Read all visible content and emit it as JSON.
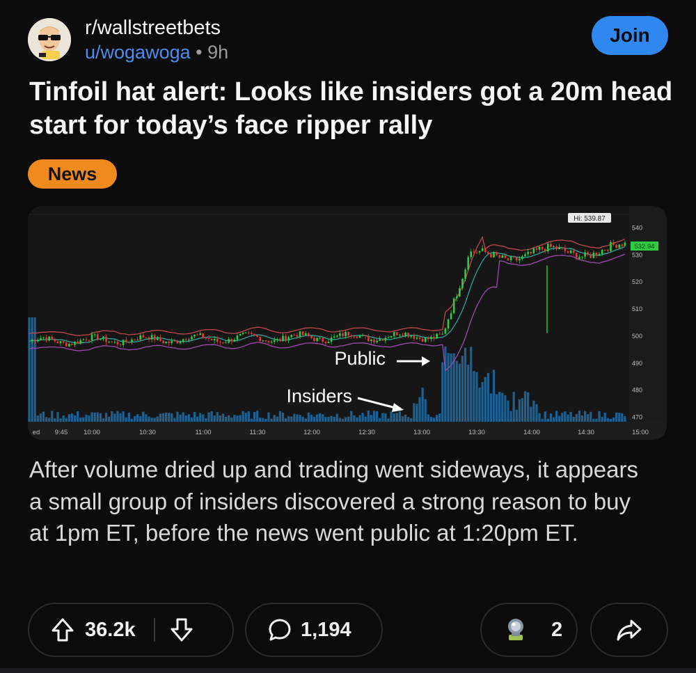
{
  "post": {
    "subreddit": "r/wallstreetbets",
    "author": "u/wogawoga",
    "separator": "•",
    "age": "9h",
    "join_label": "Join",
    "title": "Tinfoil hat alert: Looks like insiders got a 20m head start for today’s face ripper rally",
    "flair": "News",
    "flair_color": "#f08a1c",
    "body": "After volume dried up and trading went sideways, it appears a small group of insiders discovered a strong reason to buy at 1pm ET, before the news went public at 1:20pm ET."
  },
  "chart": {
    "hi_label": "Hi: 539.87",
    "last_price": "532.94",
    "y_ticks": [
      "540",
      "530",
      "520",
      "510",
      "500",
      "490",
      "480",
      "470"
    ],
    "x_ticks": [
      "ed",
      "9:45",
      "10:00",
      "10:30",
      "11:00",
      "11:30",
      "12:00",
      "12:30",
      "13:00",
      "13:30",
      "14:00",
      "14:30",
      "15:00"
    ],
    "annotation_public": "Public",
    "annotation_insiders": "Insiders",
    "up_color": "#2ecc40",
    "down_color": "#e53935",
    "volume_color": "#1f6fa8"
  },
  "actions": {
    "upvotes": "36.2k",
    "comments": "1,194",
    "awards": "2"
  },
  "colors": {
    "accent": "#2f88f0",
    "link": "#4a8ef0",
    "background": "#0b0b0c"
  }
}
